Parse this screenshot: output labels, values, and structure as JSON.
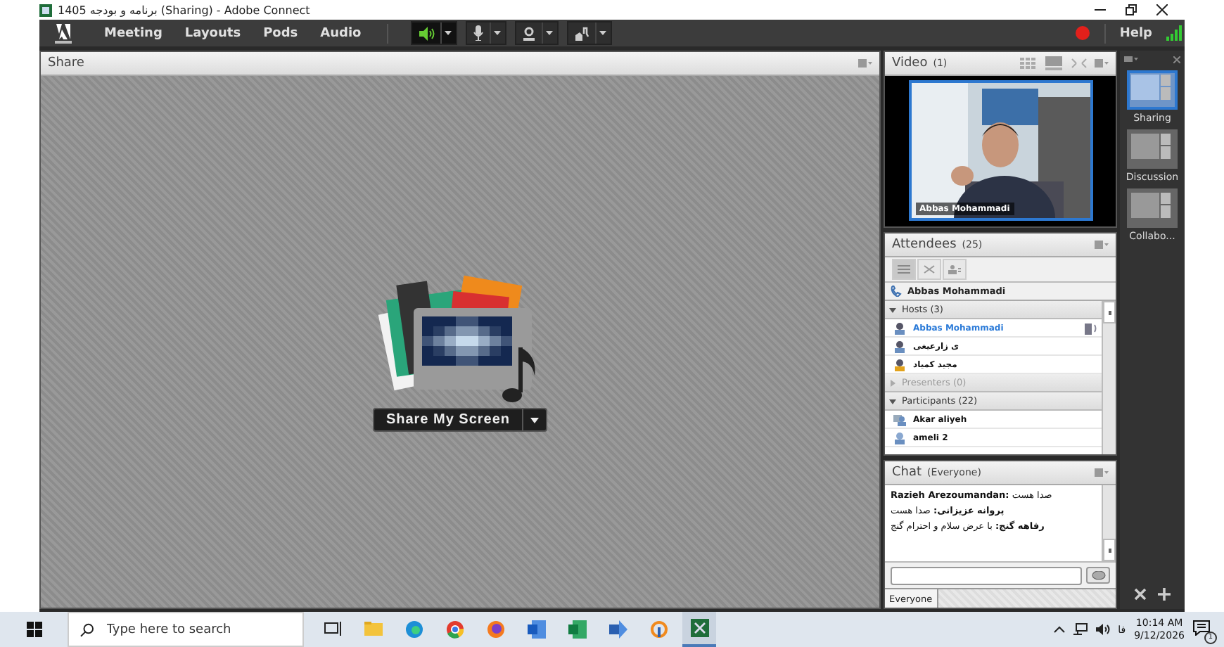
{
  "window": {
    "title": "برنامه و بودجه 1405 (Sharing) - Adobe Connect"
  },
  "menu": [
    "Meeting",
    "Layouts",
    "Pods",
    "Audio"
  ],
  "toolbar": {
    "speaker_on": true,
    "help": "Help"
  },
  "share_pod": {
    "title": "Share",
    "button": "Share My Screen"
  },
  "video_pod": {
    "title": "Video",
    "count": "(1)",
    "caption": "Abbas Mohammadi",
    "kind": "picture"
  },
  "attendees_pod": {
    "title": "Attendees",
    "count": "(25)",
    "me": "Abbas Mohammadi",
    "groups": [
      {
        "label": "Hosts (3)",
        "expanded": true,
        "disabled": false,
        "children": [
          {
            "name": "Abbas Mohammadi",
            "kind": "host",
            "selected": true
          },
          {
            "name": "ی زارعیغی",
            "kind": "host",
            "selected": false
          },
          {
            "name": "مجید کمیاد",
            "kind": "host-alert",
            "selected": false
          }
        ]
      },
      {
        "label": "Presenters (0)",
        "expanded": false,
        "disabled": true
      },
      {
        "label": "Participants (22)",
        "expanded": true,
        "disabled": false,
        "children": [
          {
            "name": "Akar aliyeh",
            "kind": "device",
            "selected": false
          },
          {
            "name": "ameli 2",
            "kind": "participant",
            "selected": false
          }
        ]
      }
    ]
  },
  "chat_pod": {
    "title": "Chat",
    "scope": "(Everyone)",
    "messages": [
      {
        "text": "**Razieh Arezoumandan:** صدا هست"
      },
      {
        "text": "**پروانه عزیزانی:** صدا هست"
      },
      {
        "text": "**رفاهه گنج:** با عرض سلام و احترام گنج"
      }
    ],
    "tabs": [
      {
        "label": "Everyone",
        "selected": true
      }
    ]
  },
  "layouts": [
    {
      "label": "Sharing",
      "selected": true
    },
    {
      "label": "Discussion",
      "selected": false
    },
    {
      "label": "Collabo...",
      "selected": false
    }
  ],
  "taskbar": {
    "search": {
      "placeholder": "Type here to search"
    },
    "language": "فا",
    "time": "10:14 AM",
    "date": "9/12/2026",
    "notifications": "1"
  }
}
